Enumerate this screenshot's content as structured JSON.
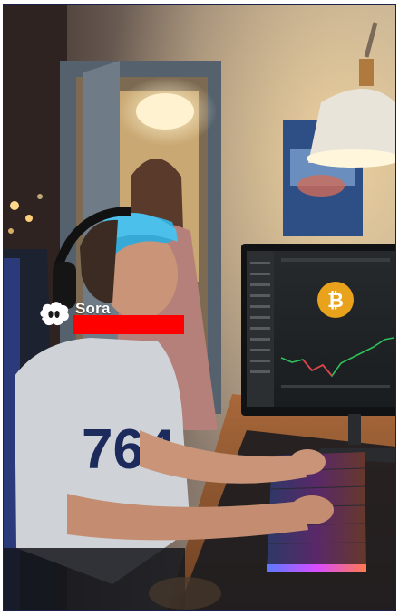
{
  "watermark": {
    "brand": "Sora",
    "logo_icon": "sora-cloud-logo-icon"
  },
  "scene": {
    "shirt_number": "764",
    "screen_coin_symbol": "₿"
  },
  "colors": {
    "frame_border": "#1b2148",
    "redaction": "#ff0000",
    "hair": "#36a9d6",
    "coin": "#e9a21c",
    "chart_up": "#2fbf5a",
    "chart_down": "#e0404a"
  }
}
